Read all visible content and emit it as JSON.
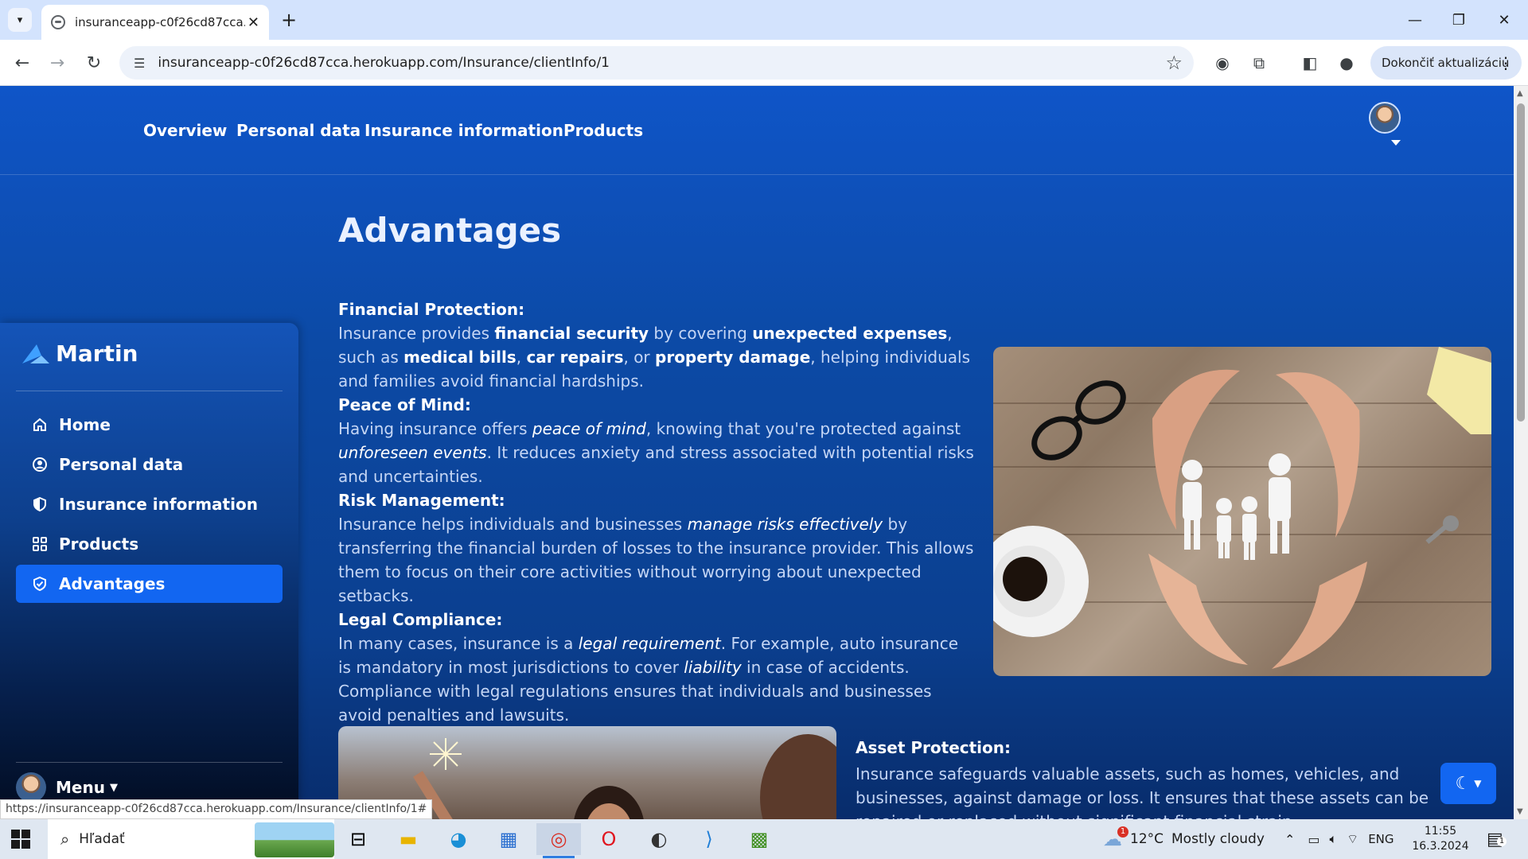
{
  "browser": {
    "tab_title": "insuranceapp-c0f26cd87cca.her",
    "url": "insuranceapp-c0f26cd87cca.herokuapp.com/Insurance/clientInfo/1",
    "update_button": "Dokončiť aktualizáciu",
    "status_url": "https://insuranceapp-c0f26cd87cca.herokuapp.com/Insurance/clientInfo/1#"
  },
  "topnav": {
    "links": [
      "Overview",
      "Personal data",
      "Insurance information",
      "Products"
    ]
  },
  "page": {
    "title": "Advantages",
    "sections": [
      {
        "heading": "Financial Protection:",
        "body": [
          {
            "t": "Insurance provides ",
            "s": "light"
          },
          {
            "t": "financial security",
            "s": "strong"
          },
          {
            "t": " by covering ",
            "s": "light"
          },
          {
            "t": "unexpected expenses",
            "s": "strong"
          },
          {
            "t": ", such as ",
            "s": "light"
          },
          {
            "t": "medical bills",
            "s": "strong"
          },
          {
            "t": ", ",
            "s": "light"
          },
          {
            "t": "car repairs",
            "s": "strong"
          },
          {
            "t": ", or ",
            "s": "light"
          },
          {
            "t": "property damage",
            "s": "strong"
          },
          {
            "t": ", helping individuals and families avoid financial hardships.",
            "s": "light"
          }
        ]
      },
      {
        "heading": "Peace of Mind:",
        "body": [
          {
            "t": "Having insurance offers ",
            "s": "light"
          },
          {
            "t": "peace of mind",
            "s": "em"
          },
          {
            "t": ", knowing that you're protected against ",
            "s": "light"
          },
          {
            "t": "unforeseen events",
            "s": "em"
          },
          {
            "t": ". It reduces anxiety and stress associated with potential risks and uncertainties.",
            "s": "light"
          }
        ]
      },
      {
        "heading": "Risk Management:",
        "body": [
          {
            "t": "Insurance helps individuals and businesses ",
            "s": "light"
          },
          {
            "t": "manage risks effectively",
            "s": "em"
          },
          {
            "t": " by transferring the financial burden of losses to the insurance provider. This allows them to focus on their core activities without worrying about unexpected setbacks.",
            "s": "light"
          }
        ]
      },
      {
        "heading": "Legal Compliance:",
        "body": [
          {
            "t": "In many cases, insurance is a ",
            "s": "light"
          },
          {
            "t": "legal requirement",
            "s": "em"
          },
          {
            "t": ". For example, auto insurance is mandatory in most jurisdictions to cover ",
            "s": "light"
          },
          {
            "t": "liability",
            "s": "em"
          },
          {
            "t": " in case of accidents. Compliance with legal regulations ensures that individuals and businesses avoid penalties and lawsuits.",
            "s": "light"
          }
        ]
      }
    ],
    "asset_heading": "Asset Protection:",
    "asset_body": "Insurance safeguards valuable assets, such as homes, vehicles, and businesses, against damage or loss. It ensures that these assets can be repaired or replaced without significant financial strain."
  },
  "sidebar": {
    "brand": "Martin",
    "items": [
      {
        "label": "Home",
        "icon": "home-icon",
        "active": false
      },
      {
        "label": "Personal data",
        "icon": "user-circle-icon",
        "active": false
      },
      {
        "label": "Insurance information",
        "icon": "shield-half-icon",
        "active": false
      },
      {
        "label": "Products",
        "icon": "grid-icon",
        "active": false
      },
      {
        "label": "Advantages",
        "icon": "shield-check-icon",
        "active": true
      }
    ],
    "menu_label": "Menu"
  },
  "taskbar": {
    "search_placeholder": "Hľadať",
    "weather_temp": "12°C",
    "weather_text": "Mostly cloudy",
    "weather_badge": "1",
    "language": "ENG",
    "time": "11:55",
    "date": "16.3.2024",
    "notifications": "1"
  },
  "colors": {
    "accent": "#1266f1",
    "page_bg": "#0d4aa8"
  }
}
